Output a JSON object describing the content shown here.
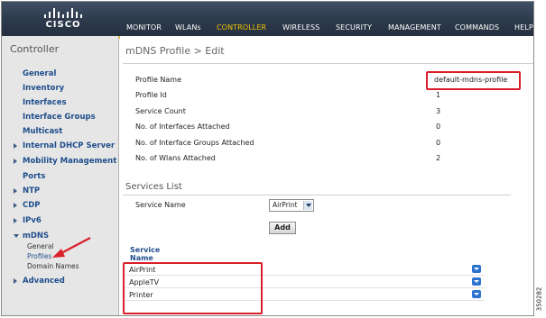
{
  "brand": {
    "logo_text": "CISCO"
  },
  "nav": {
    "items": [
      "MONITOR",
      "WLANs",
      "CONTROLLER",
      "WIRELESS",
      "SECURITY",
      "MANAGEMENT",
      "COMMANDS",
      "HELP"
    ],
    "active": "CONTROLLER"
  },
  "sidebar": {
    "title": "Controller",
    "items": [
      "General",
      "Inventory",
      "Interfaces",
      "Interface Groups",
      "Multicast",
      "Internal DHCP Server",
      "Mobility Management",
      "Ports",
      "NTP",
      "CDP",
      "IPv6",
      "mDNS",
      "Advanced"
    ],
    "mdns_sub": [
      "General",
      "Profiles",
      "Domain Names"
    ]
  },
  "page": {
    "title": "mDNS Profile > Edit",
    "fields": [
      {
        "label": "Profile Name",
        "value": "default-mdns-profile"
      },
      {
        "label": "Profile Id",
        "value": "1"
      },
      {
        "label": "Service Count",
        "value": "3"
      },
      {
        "label": "No. of Interfaces Attached",
        "value": "0"
      },
      {
        "label": "No. of Interface Groups Attached",
        "value": "0"
      },
      {
        "label": "No. of Wlans Attached",
        "value": "2"
      }
    ]
  },
  "services": {
    "title": "Services List",
    "service_name_label": "Service Name",
    "selected_service": "AirPrint",
    "add_label": "Add",
    "column_header_line1": "Service",
    "column_header_line2": "Name",
    "rows": [
      "AirPrint",
      "AppleTV",
      "Printer"
    ]
  },
  "figure_id": "350282",
  "colors": {
    "header": "#2c3a4c",
    "accent": "#f2c200",
    "link": "#1f4e8c",
    "highlight": "#d9202a"
  }
}
